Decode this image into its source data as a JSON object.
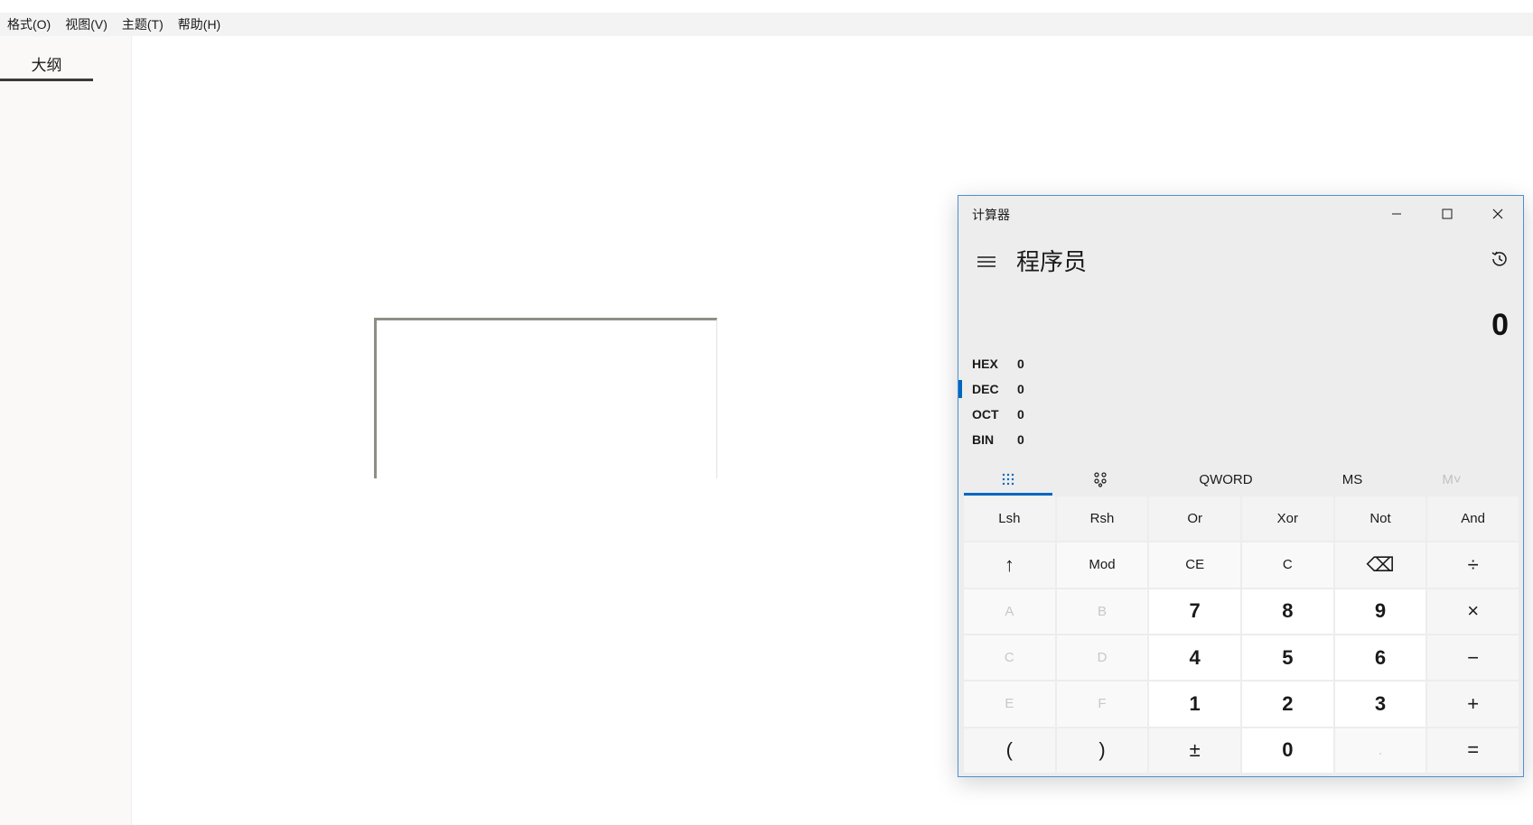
{
  "menubar": {
    "items": [
      "格式(O)",
      "视图(V)",
      "主题(T)",
      "帮助(H)"
    ]
  },
  "sidebar": {
    "tab_label": "大纲"
  },
  "calculator": {
    "title": "计算器",
    "mode": "程序员",
    "display_value": "0",
    "radix": [
      {
        "name": "HEX",
        "value": "0",
        "active": false
      },
      {
        "name": "DEC",
        "value": "0",
        "active": true
      },
      {
        "name": "OCT",
        "value": "0",
        "active": false
      },
      {
        "name": "BIN",
        "value": "0",
        "active": false
      }
    ],
    "tabs": {
      "keypad_icon": "keypad-grid-icon",
      "bit_icon": "bit-toggle-icon",
      "word_size": "QWORD",
      "memory_store": "MS",
      "memory_recall": "M˅"
    },
    "keys": [
      [
        "Lsh",
        "Rsh",
        "Or",
        "Xor",
        "Not",
        "And"
      ],
      [
        "↑",
        "Mod",
        "CE",
        "C",
        "⌫",
        "÷"
      ],
      [
        "A",
        "B",
        "7",
        "8",
        "9",
        "×"
      ],
      [
        "C",
        "D",
        "4",
        "5",
        "6",
        "−"
      ],
      [
        "E",
        "F",
        "1",
        "2",
        "3",
        "+"
      ],
      [
        "(",
        ")",
        "±",
        "0",
        ".",
        "="
      ]
    ],
    "accent_color": "#0067c0"
  }
}
